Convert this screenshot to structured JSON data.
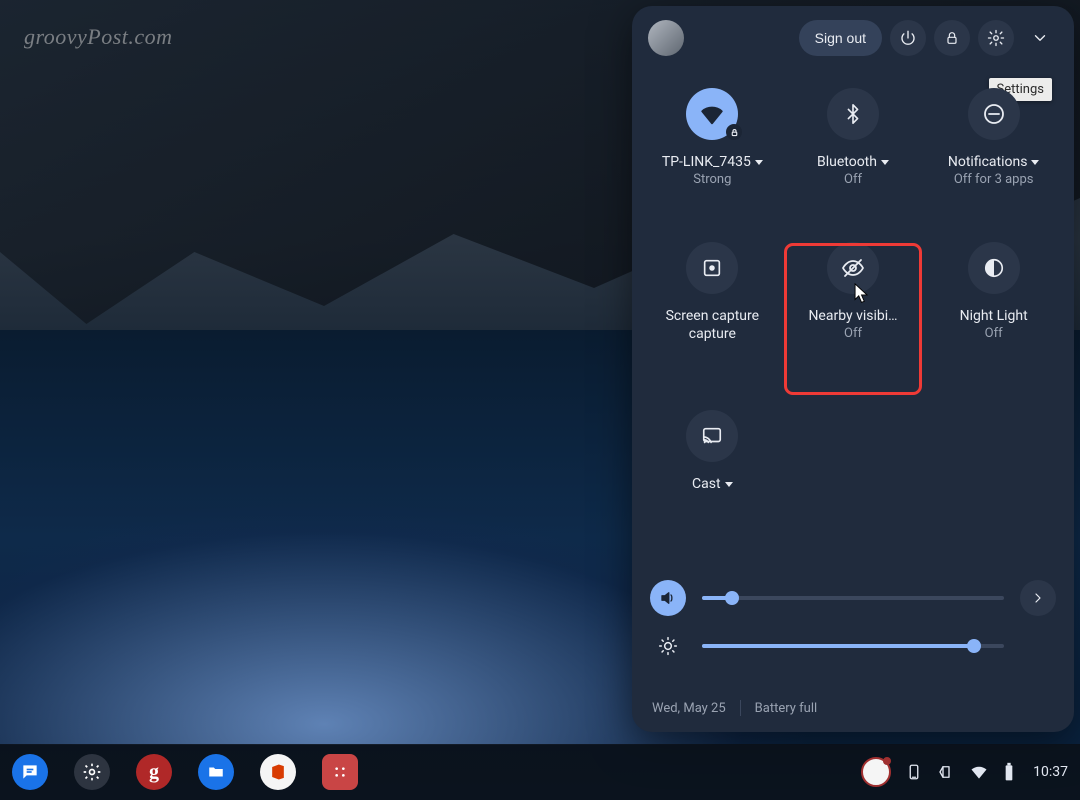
{
  "watermark": "groovyPost.com",
  "header": {
    "sign_out": "Sign out",
    "tooltip": "Settings"
  },
  "tiles": [
    {
      "label": "TP-LINK_7435",
      "sub": "Strong",
      "has_caret": true,
      "on": true
    },
    {
      "label": "Bluetooth",
      "sub": "Off",
      "has_caret": true,
      "on": false
    },
    {
      "label": "Notifications",
      "sub": "Off for 3 apps",
      "has_caret": true,
      "on": false
    },
    {
      "label": "Screen capture",
      "sub": "",
      "has_caret": false,
      "on": false
    },
    {
      "label": "Nearby visibi…",
      "sub": "Off",
      "has_caret": false,
      "on": false
    },
    {
      "label": "Night Light",
      "sub": "Off",
      "has_caret": false,
      "on": false
    },
    {
      "label": "Cast",
      "sub": "",
      "has_caret": true,
      "on": false
    }
  ],
  "sliders": {
    "volume_percent": 10,
    "brightness_percent": 90
  },
  "footer": {
    "date": "Wed, May 25",
    "battery": "Battery full"
  },
  "shelf": {
    "time": "10:37"
  }
}
